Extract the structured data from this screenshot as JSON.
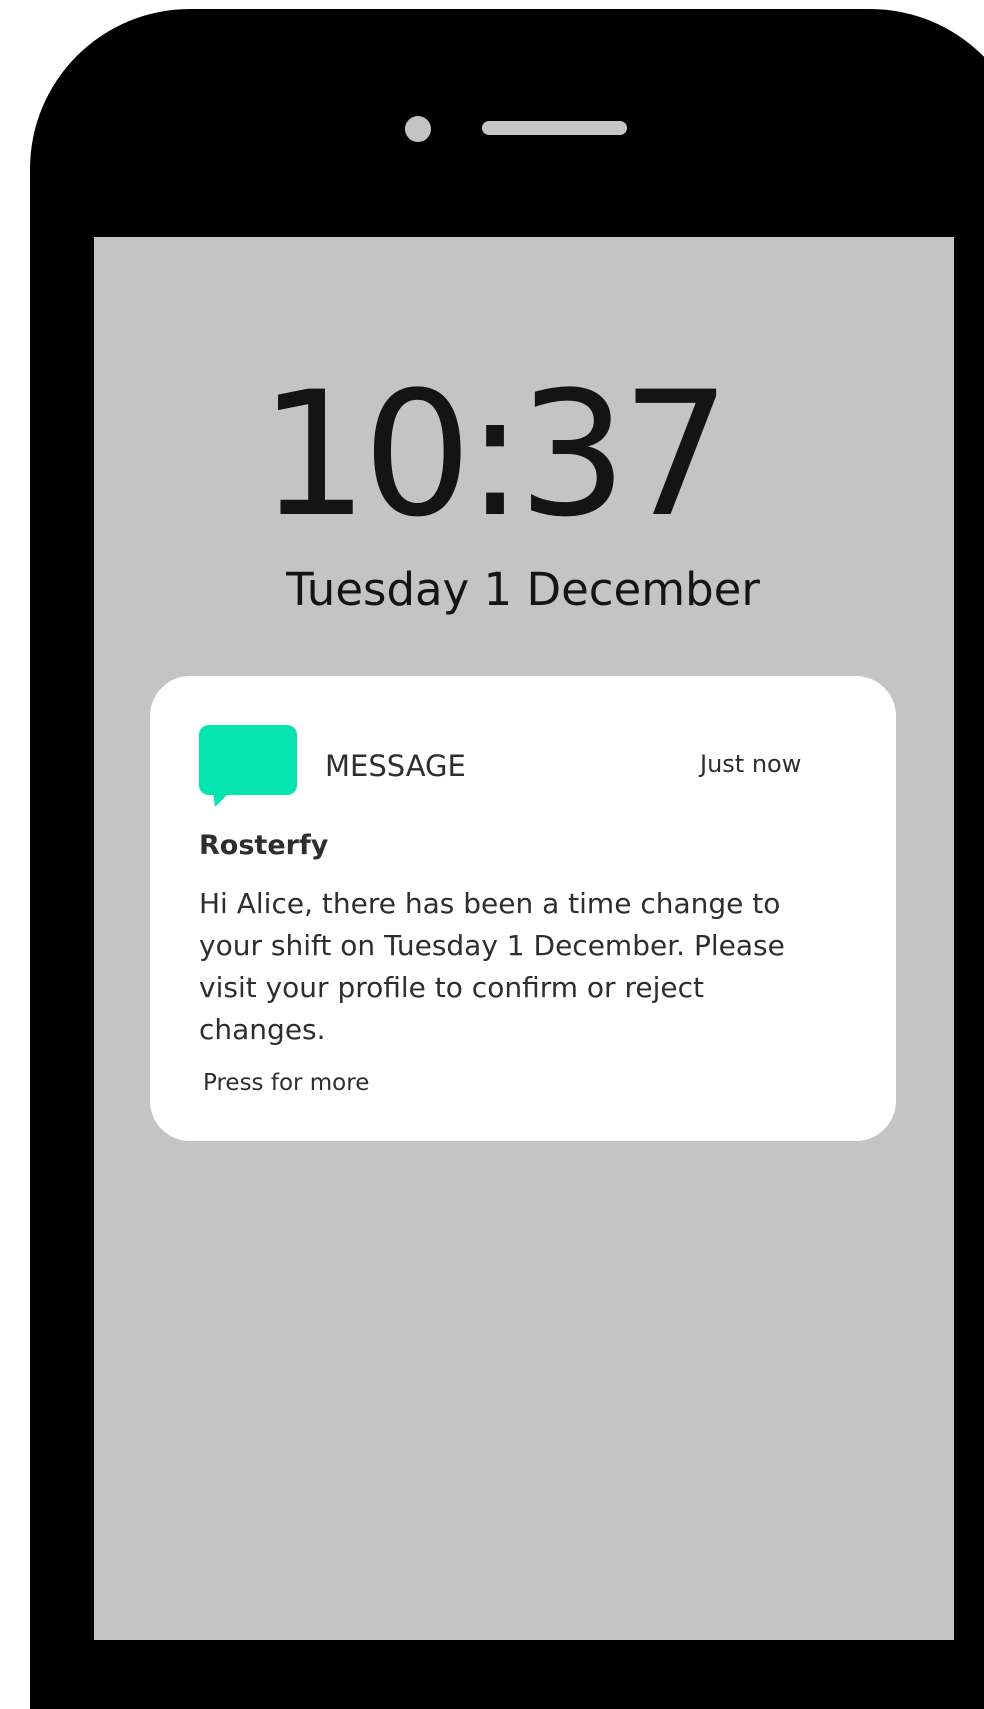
{
  "lock_screen": {
    "time": "10:37",
    "date": "Tuesday 1 December"
  },
  "notification": {
    "app_name": "MESSAGE",
    "received": "Just now",
    "sender": "Rosterfy",
    "body": "Hi Alice, there has been a time change to your shift on Tuesday 1 December. Please visit your profile to confirm or reject changes.",
    "action": "Press for more",
    "icon": "speech-bubble-icon",
    "icon_color": "#06e4b0"
  },
  "colors": {
    "phone_body": "#000000",
    "screen": "#c4c4c4",
    "card": "#ffffff",
    "text": "#141414"
  }
}
